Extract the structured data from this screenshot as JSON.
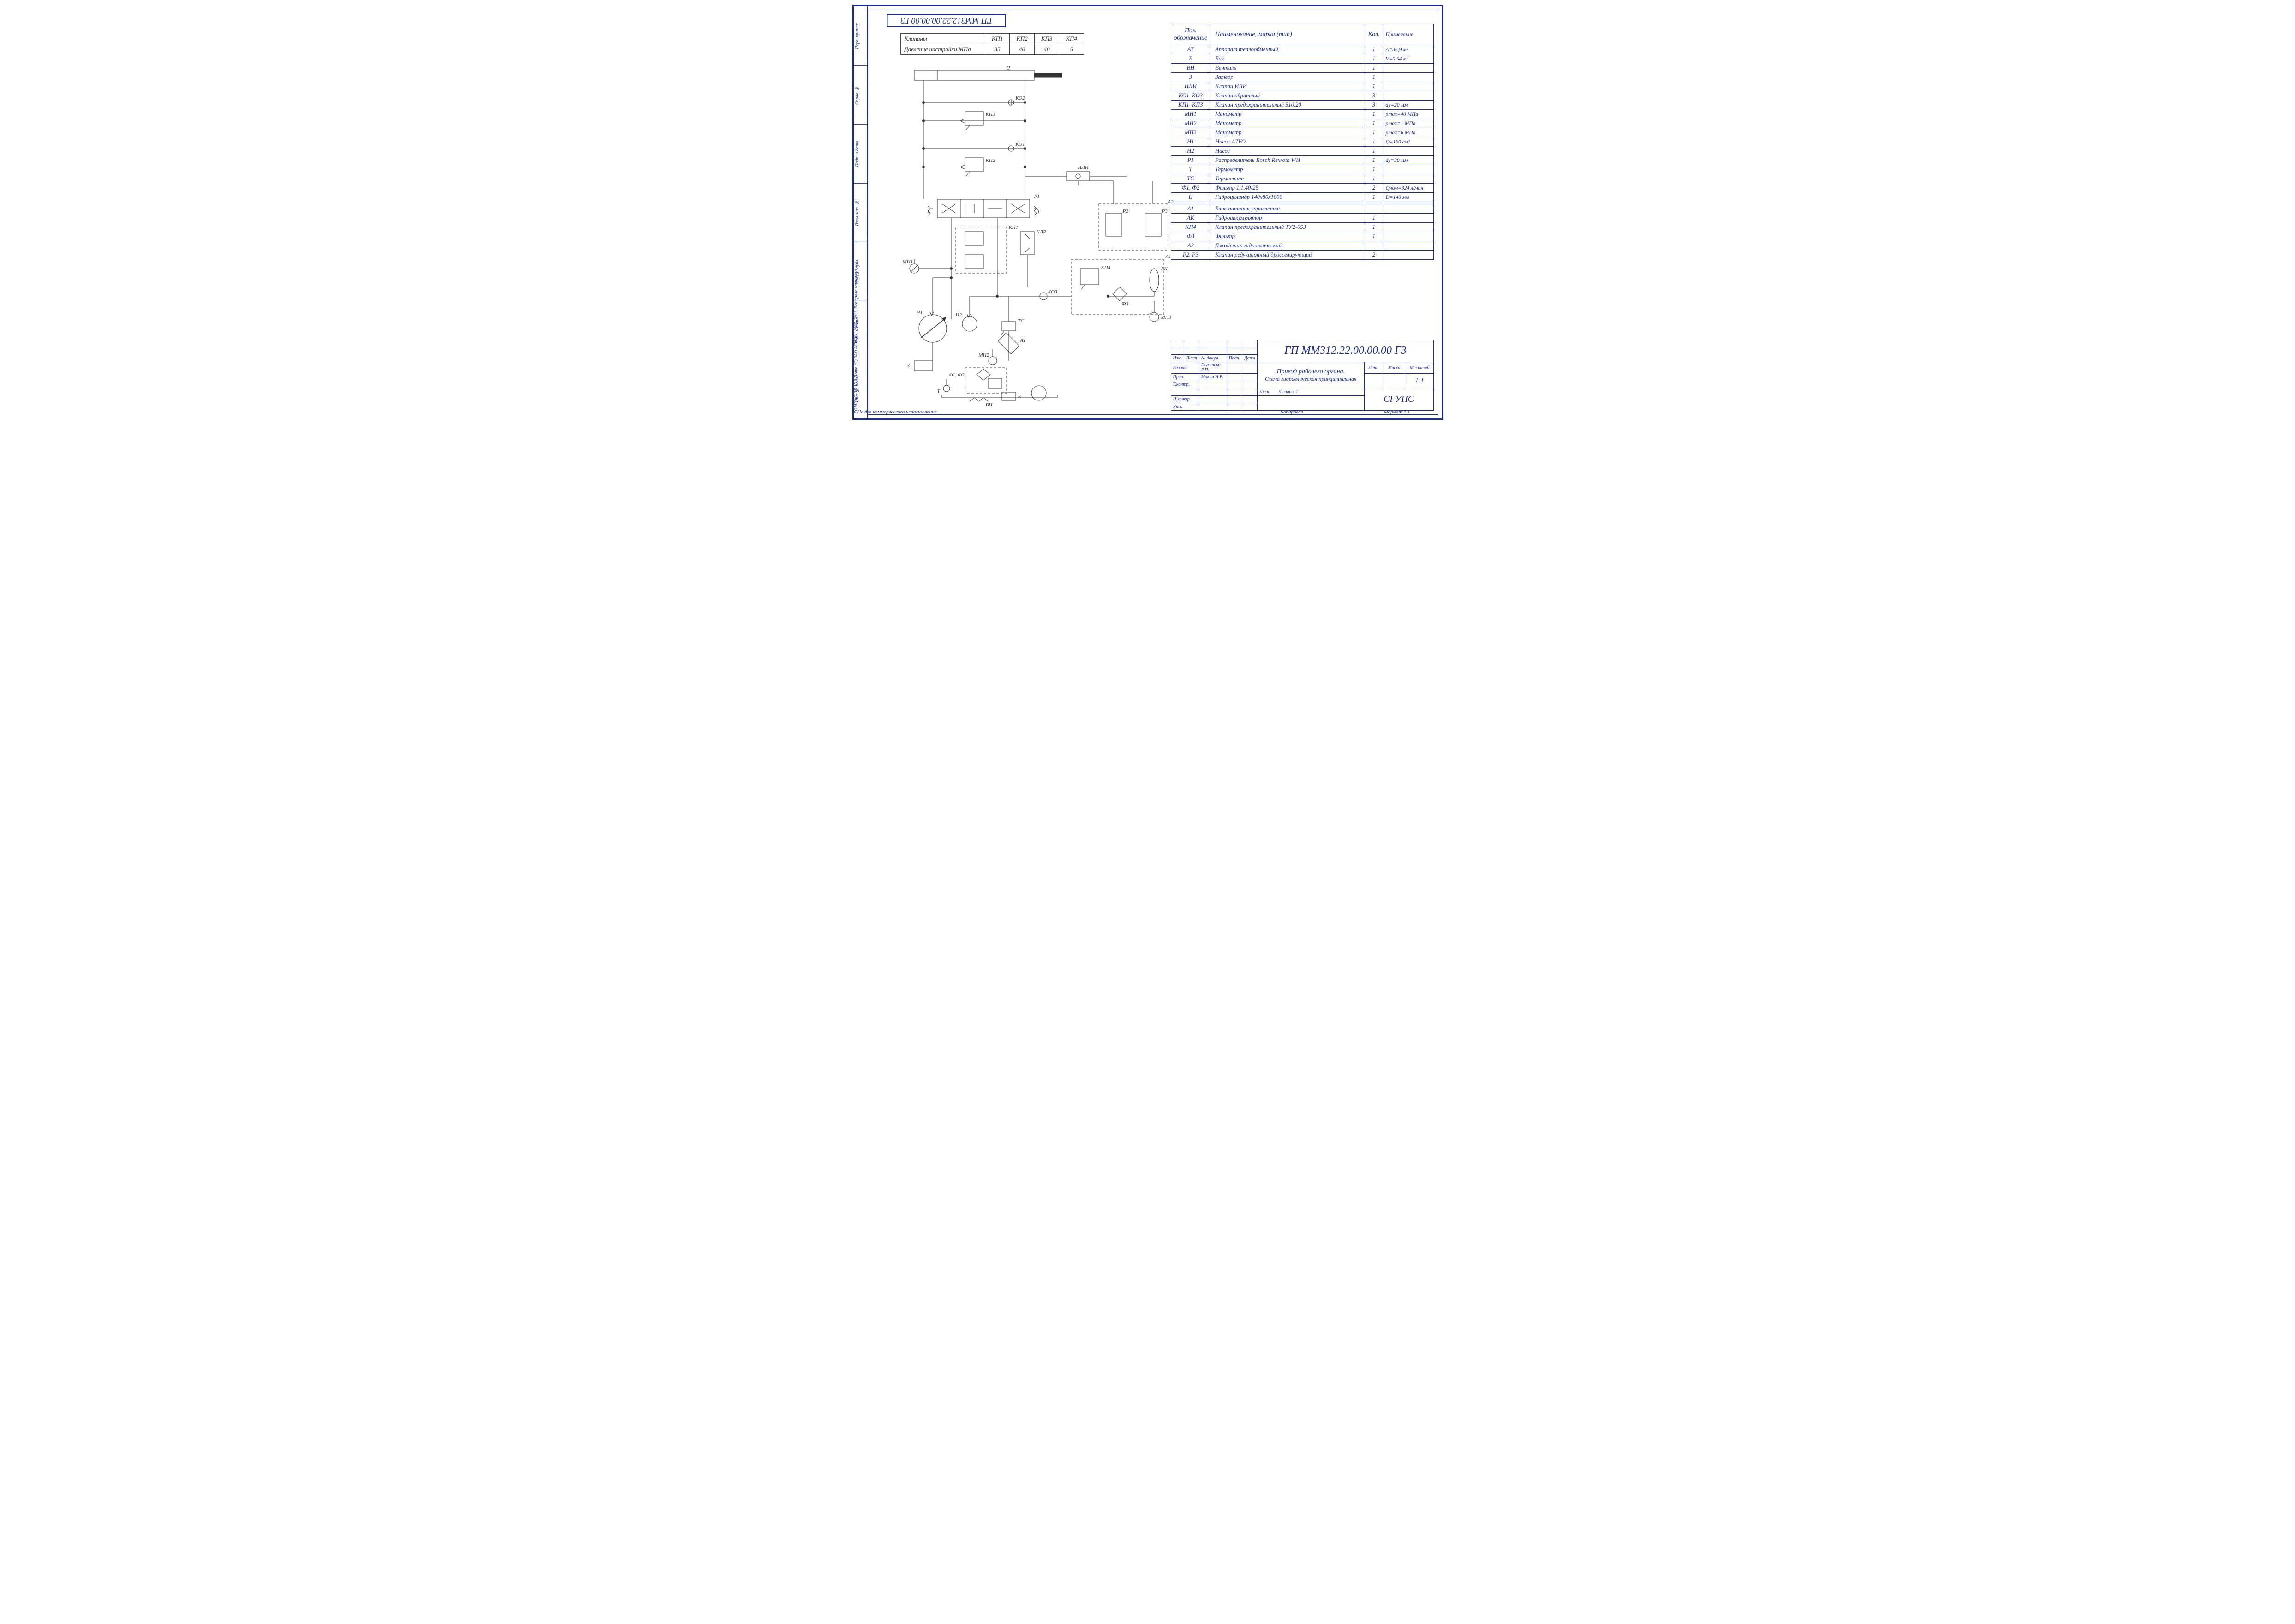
{
  "doc_number": "ГП ММ312.22.00.00.00 Г3",
  "valve_table": {
    "row_label": "Клапаны",
    "headers": [
      "КП1",
      "КП2",
      "КП3",
      "КП4"
    ],
    "param_label": "Давление настройки,МПа",
    "values": [
      "35",
      "40",
      "40",
      "5"
    ]
  },
  "bom": {
    "headers": {
      "pos": "Поз. обозначение",
      "name": "Наименование, марка (тип)",
      "qty": "Кол.",
      "note": "Примечание"
    },
    "rows": [
      {
        "pos": "АТ",
        "name": "Аппарат теплообменный",
        "qty": "1",
        "note": "A=36,9 м²"
      },
      {
        "pos": "Б",
        "name": "Бак",
        "qty": "1",
        "note": "V=0,54 м³"
      },
      {
        "pos": "ВН",
        "name": "Вентиль",
        "qty": "1",
        "note": ""
      },
      {
        "pos": "З",
        "name": "Затвор",
        "qty": "1",
        "note": ""
      },
      {
        "pos": "ИЛИ",
        "name": "Клапан ИЛИ",
        "qty": "1",
        "note": ""
      },
      {
        "pos": "КО1–КО3",
        "name": "Клапан обратный",
        "qty": "3",
        "note": ""
      },
      {
        "pos": "КП1–КП3",
        "name": "Клапан предохранительный 510.20",
        "qty": "3",
        "note": "dу=20 мм"
      },
      {
        "pos": "МН1",
        "name": "Манометр",
        "qty": "1",
        "note": "pmax=40 МПа"
      },
      {
        "pos": "МН2",
        "name": "Манометр",
        "qty": "1",
        "note": "pmax=1 МПа"
      },
      {
        "pos": "МН3",
        "name": "Манометр",
        "qty": "1",
        "note": "pmax=6 МПа"
      },
      {
        "pos": "Н1",
        "name": "Насос A7VO",
        "qty": "1",
        "note": "Q=160 см³"
      },
      {
        "pos": "Н2",
        "name": "Насос",
        "qty": "1",
        "note": ""
      },
      {
        "pos": "Р1",
        "name": "Распределитель Bosch Rexroth WH",
        "qty": "1",
        "note": "dу=30 мм"
      },
      {
        "pos": "Т",
        "name": "Термометр",
        "qty": "1",
        "note": ""
      },
      {
        "pos": "ТС",
        "name": "Термостат",
        "qty": "1",
        "note": ""
      },
      {
        "pos": "Ф1, Ф2",
        "name": "Фильтр 1.1.40-25",
        "qty": "2",
        "note": "Qном=324 л/мин"
      },
      {
        "pos": "Ц",
        "name": "Гидроцилиндр 140х80х1800",
        "qty": "1",
        "note": "D=140 мм"
      },
      {
        "pos": "",
        "name": "",
        "qty": "",
        "note": ""
      },
      {
        "pos": "А1",
        "name": "Блок питания управления:",
        "qty": "",
        "note": "",
        "u": true
      },
      {
        "pos": "АК",
        "name": "Гидроаккумулятор",
        "qty": "1",
        "note": ""
      },
      {
        "pos": "КП4",
        "name": "Клапан предохранительный ТУ2-053",
        "qty": "1",
        "note": ""
      },
      {
        "pos": "Ф3",
        "name": "Фильтр",
        "qty": "1",
        "note": ""
      },
      {
        "pos": "А2",
        "name": "Джойстик гидравлический:",
        "qty": "",
        "note": "",
        "u": true
      },
      {
        "pos": "Р2, Р3",
        "name": "Клапан редукционный дросселирующий",
        "qty": "2",
        "note": ""
      }
    ]
  },
  "schematic_labels": {
    "Ц": "Ц",
    "КО2": "КО2",
    "КП3": "КП3",
    "КО1": "КО1",
    "КП2": "КП2",
    "ИЛИ": "ИЛИ",
    "Р1": "Р1",
    "КП1": "КП1",
    "КЛР": "КЛР",
    "А2": "А2",
    "Р2": "Р2",
    "Р3": "Р3",
    "МН1": "МН1",
    "КП4": "КП4",
    "АК": "АК",
    "А1": "А1",
    "КО3": "КО3",
    "Ф3": "Ф3",
    "МН3": "МН3",
    "Н1": "Н1",
    "Н2": "Н2",
    "ТС": "ТС",
    "АТ": "АТ",
    "МН2": "МН2",
    "Ф1Ф2": "Ф1, Ф2",
    "З": "З",
    "Т": "Т",
    "ВН": "ВН",
    "Б": "Б"
  },
  "title_block": {
    "doc_number": "ГП ММ312.22.00.00.00 Г3",
    "title1": "Привод рабочего органа.",
    "title2": "Схема гидравлическая принципиальная",
    "org": "СГУПС",
    "scale_label": "Масштаб",
    "scale": "1:1",
    "mass_label": "Масса",
    "lit_label": "Лит.",
    "sheet_label": "Лист",
    "sheets_label": "Листов",
    "sheets": "1",
    "roles": {
      "izm": "Изм.",
      "list": "Лист",
      "ndoc": "№ докум.",
      "podp": "Подп.",
      "data": "Дата",
      "razrab": "Разраб.",
      "razrab_name": "Глуханько Р.П.",
      "prov": "Пров.",
      "prov_name": "Мокин Н.В.",
      "tkontr": "Т.контр.",
      "nkontr": "Н.контр.",
      "utv": "Утв."
    }
  },
  "sidebar": [
    "Перв. примен.",
    "Справ. №",
    "Подп. и дата",
    "Взам. инв. №",
    "Инв. № дубл.",
    "Подп. и дата",
    "Инв. № подл."
  ],
  "footer": {
    "left": "Не для коммерческого использования",
    "copy": "Копировал",
    "format": "Формат   A3",
    "software": "КОМПАС-3D V13 Home (С) ЗАО АСКОН, 1989–2011. Все права защищены."
  }
}
